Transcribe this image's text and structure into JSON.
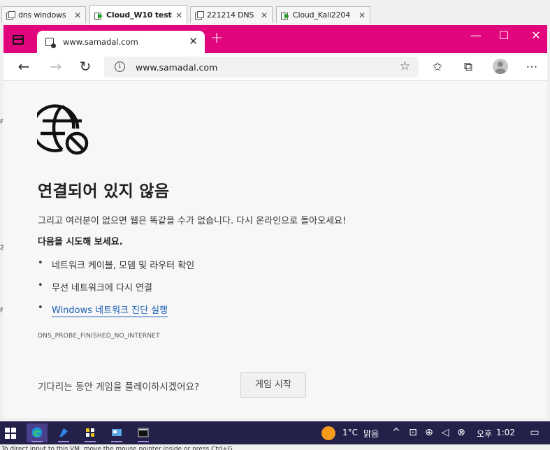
{
  "vm_tabs": [
    {
      "label": "dns windows",
      "running": false,
      "active": false
    },
    {
      "label": "Cloud_W10 test",
      "running": true,
      "active": true
    },
    {
      "label": "221214 DNS",
      "running": false,
      "active": false
    },
    {
      "label": "Cloud_Kali2204",
      "running": true,
      "active": false
    }
  ],
  "browser": {
    "accent_color": "#e2067e",
    "tab_title": "www.samadal.com",
    "new_tab": "+",
    "url": "www.samadal.com"
  },
  "error_page": {
    "title": "연결되어 있지 않음",
    "description": "그리고 여러분이 없으면 웹은 똑같을 수가 없습니다. 다시 온라인으로 돌아오세요!",
    "try_heading": "다음을 시도해 보세요.",
    "suggestions": [
      {
        "text": "네트워크 케이블, 모뎀 및 라우터 확인",
        "link": false
      },
      {
        "text": "무선 네트워크에 다시 연결",
        "link": false
      },
      {
        "text": "Windows 네트워크 진단 실행",
        "link": true
      }
    ],
    "bullet": "•",
    "error_code": "DNS_PROBE_FINISHED_NO_INTERNET",
    "game_question": "기다리는 동안 게임을 플레이하시겠어요?",
    "game_button": "게임 시작"
  },
  "taskbar": {
    "temperature": "1°C",
    "weather": "맑음",
    "ampm": "오후",
    "time": "1:02"
  },
  "status_strip": "To direct input to this VM, move the mouse pointer inside or press Ctrl+G."
}
